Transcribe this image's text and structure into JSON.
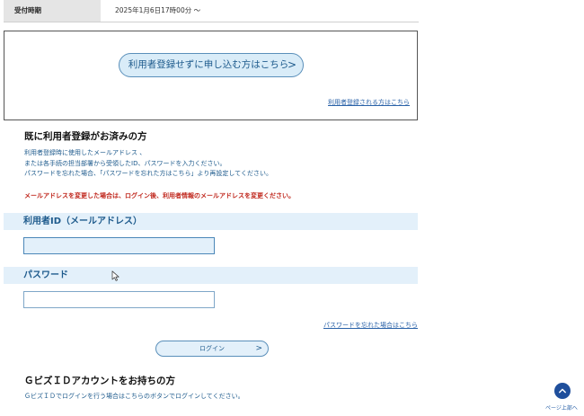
{
  "reception": {
    "label": "受付時期",
    "value": "2025年1月6日17時00分 ～"
  },
  "guest": {
    "apply_button": "利用者登録せずに申し込む方はこちら",
    "apply_chevron": ">",
    "register_link": "利用者登録される方はこちら"
  },
  "registered": {
    "title": "既に利用者登録がお済みの方",
    "desc_lines": [
      "利用者登録時に使用したメールアドレス 、",
      "または各手続の担当部署から受領したID、パスワードを入力ください。",
      "パスワードを忘れた場合、「パスワードを忘れた方はこちら」より再設定してください。"
    ],
    "warning": "メールアドレスを変更した場合は、ログイン後、利用者情報のメールアドレスを変更ください。"
  },
  "fields": {
    "email_label": "利用者ID（メールアドレス）",
    "email_value": "",
    "password_label": "パスワード",
    "password_value": ""
  },
  "forgot_link": "パスワードを忘れた場合はこちら",
  "login": {
    "label": "ログイン",
    "chevron": ">"
  },
  "gbiz": {
    "title": "ＧビズＩＤアカウントをお持ちの方",
    "desc": "ＧビズＩＤでログインを行う場合はこちらのボタンでログインしてください。"
  },
  "page_top": {
    "label": "ページ上部へ"
  },
  "colors": {
    "accent": "#1d5a8c",
    "warning": "#c0281e",
    "bar": "#e3f0fa",
    "top_button": "#1f4f9c"
  }
}
